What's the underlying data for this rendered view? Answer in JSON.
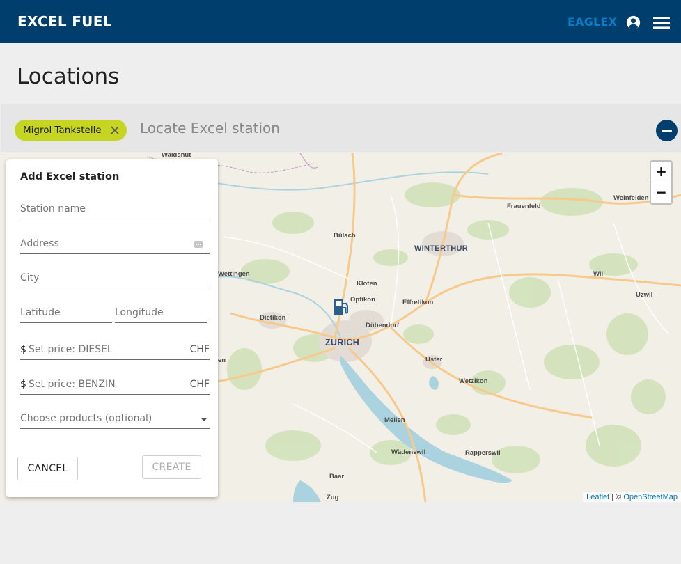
{
  "header": {
    "brand": "EXCEL FUEL",
    "user_label": "EAGLEX",
    "icons": {
      "avatar": "account-circle-icon",
      "menu": "hamburger-menu-icon"
    },
    "colors": {
      "bar": "#003e6e",
      "user_label": "#0b7dc4"
    }
  },
  "page": {
    "title": "Locations"
  },
  "search": {
    "chip_label": "Migrol Tankstelle",
    "chip_color": "#c6d422",
    "placeholder": "Locate Excel station"
  },
  "map": {
    "places": {
      "waldshut": "Waldshut",
      "frauenfeld": "Frauenfeld",
      "weinfelden": "Weinfelden",
      "bulach": "Bülach",
      "winterthur": "WINTERTHUR",
      "wettingen": "Wettingen",
      "kloten": "Kloten",
      "opfikon": "Opfikon",
      "effretikon": "Effretikon",
      "wil": "Wil",
      "uzwil": "Uzwil",
      "dietikon": "Dietikon",
      "dubendorf": "Dübendorf",
      "zurich": "ZURICH",
      "uster": "Uster",
      "wetzikon": "Wetzikon",
      "meilen": "Meilen",
      "wadenswil": "Wädenswil",
      "rapperswil": "Rapperswil",
      "baar": "Baar",
      "zug": "Zug",
      "partial_left": "en"
    },
    "zoom_in": "+",
    "zoom_out": "−",
    "attribution": {
      "leaflet": "Leaflet",
      "sep": " | © ",
      "osm": "OpenStreetMap"
    },
    "marker_icon": "fuel-pump-icon"
  },
  "form": {
    "title": "Add Excel station",
    "station_name_placeholder": "Station name",
    "address_placeholder": "Address",
    "city_placeholder": "City",
    "latitude_placeholder": "Latitude",
    "longitude_placeholder": "Longitude",
    "price_prefix": "$",
    "diesel_placeholder": "Set price: DIESEL",
    "benzin_placeholder": "Set price: BENZIN",
    "currency": "CHF",
    "products_placeholder": "Choose products (optional)",
    "cancel_label": "CANCEL",
    "create_label": "CREATE"
  }
}
